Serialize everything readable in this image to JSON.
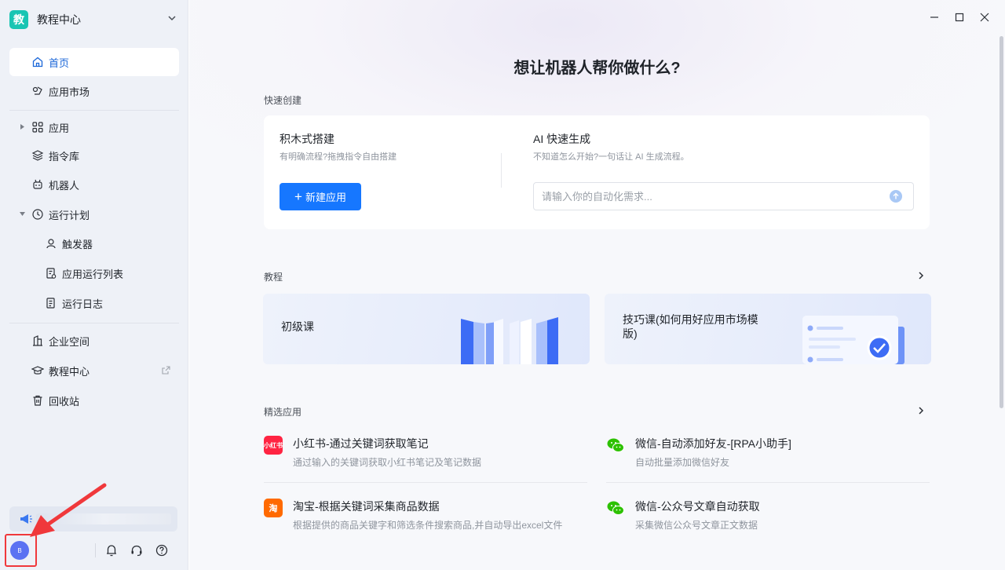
{
  "colors": {
    "accent": "#1677ff",
    "workspace_logo": "#19c5b3",
    "avatar": "#5b72f2",
    "highlight": "#f0383b"
  },
  "workspace": {
    "logo_text": "教",
    "name": "教程中心"
  },
  "sidebar": {
    "items": [
      {
        "label": "首页",
        "icon": "home-icon",
        "active": true
      },
      {
        "label": "应用市场",
        "icon": "app-market-icon"
      },
      {
        "label": "应用",
        "icon": "grid-icon",
        "caret": "right"
      },
      {
        "label": "指令库",
        "icon": "layers-icon"
      },
      {
        "label": "机器人",
        "icon": "robot-icon"
      },
      {
        "label": "运行计划",
        "icon": "clock-icon",
        "caret": "down"
      },
      {
        "label": "触发器",
        "icon": "trigger-icon",
        "sub": true
      },
      {
        "label": "应用运行列表",
        "icon": "run-list-icon",
        "sub": true
      },
      {
        "label": "运行日志",
        "icon": "log-icon",
        "sub": true
      },
      {
        "label": "企业空间",
        "icon": "enterprise-icon"
      },
      {
        "label": "教程中心",
        "icon": "graduation-cap-icon",
        "external": true
      },
      {
        "label": "回收站",
        "icon": "trash-icon"
      }
    ],
    "avatar_text": "B"
  },
  "main": {
    "title": "想让机器人帮你做什么?",
    "quick_create": {
      "label": "快速创建",
      "block": {
        "title": "积木式搭建",
        "desc": "有明确流程?拖拽指令自由搭建",
        "button": "新建应用"
      },
      "ai": {
        "title": "AI 快速生成",
        "desc": "不知道怎么开始?一句话让 AI 生成流程。",
        "placeholder": "请输入你的自动化需求..."
      }
    },
    "tutorials": {
      "label": "教程",
      "cards": [
        {
          "title": "初级课"
        },
        {
          "title": "技巧课(如何用好应用市场模版)",
          "line1": "技巧课(如何用好应用市场模",
          "line2": "版)"
        }
      ]
    },
    "featured": {
      "label": "精选应用",
      "apps": [
        {
          "name": "小红书-通过关键词获取笔记",
          "desc": "通过输入的关键词获取小红书笔记及笔记数据",
          "icon": "xiaohongshu-icon",
          "icon_text": "小红书",
          "color": "#ff2442"
        },
        {
          "name": "微信-自动添加好友-[RPA小助手]",
          "desc": "自动批量添加微信好友",
          "icon": "wechat-icon",
          "color": "#2dc100"
        },
        {
          "name": "淘宝-根据关键词采集商品数据",
          "desc": "根据提供的商品关键字和筛选条件搜索商品,并自动导出excel文件",
          "icon": "taobao-icon",
          "icon_text": "淘",
          "color": "#ff6a00"
        },
        {
          "name": "微信-公众号文章自动获取",
          "desc": "采集微信公众号文章正文数据",
          "icon": "wechat-icon",
          "color": "#2dc100"
        }
      ]
    }
  }
}
